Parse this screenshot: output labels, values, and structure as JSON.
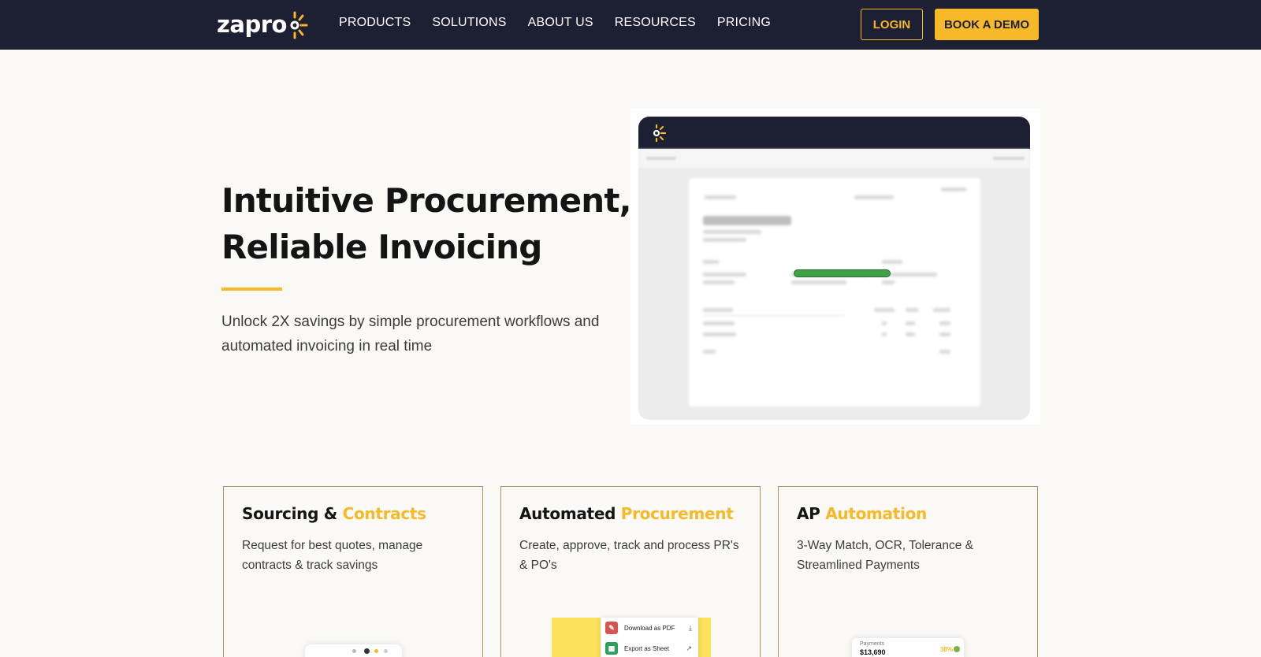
{
  "nav": {
    "logo_text": "zapro",
    "links": [
      "PRODUCTS",
      "SOLUTIONS",
      "ABOUT US",
      "RESOURCES",
      "PRICING"
    ],
    "login_label": "LOGIN",
    "demo_label": "BOOK A DEMO"
  },
  "hero": {
    "title_line1": "Intuitive Procurement,",
    "title_line2": "Reliable Invoicing",
    "subtitle": "Unlock 2X savings by simple procurement workflows and automated invoicing in real time"
  },
  "preview": {
    "progress_fraction": 1.0
  },
  "cards": [
    {
      "title_plain": "Sourcing & ",
      "title_accent": "Contracts",
      "description": "Request for best quotes, manage contracts & track savings"
    },
    {
      "title_plain": "Automated ",
      "title_accent": "Procurement",
      "description": "Create, approve, track and process PR's & PO's",
      "menu": [
        {
          "label": "Download as PDF",
          "icon": "pdf-icon"
        },
        {
          "label": "Export as Sheet",
          "icon": "sheet-icon"
        }
      ]
    },
    {
      "title_plain": "AP ",
      "title_accent": "Automation",
      "description": "3-Way Match, OCR, Tolerance & Streamlined Payments",
      "widget": {
        "label": "Payments",
        "value": "$13,690",
        "percent": "38%"
      }
    }
  ],
  "colors": {
    "nav_bg": "#1d1f33",
    "accent": "#f7b928",
    "page_bg": "#faf9f6",
    "success": "#43a047"
  }
}
